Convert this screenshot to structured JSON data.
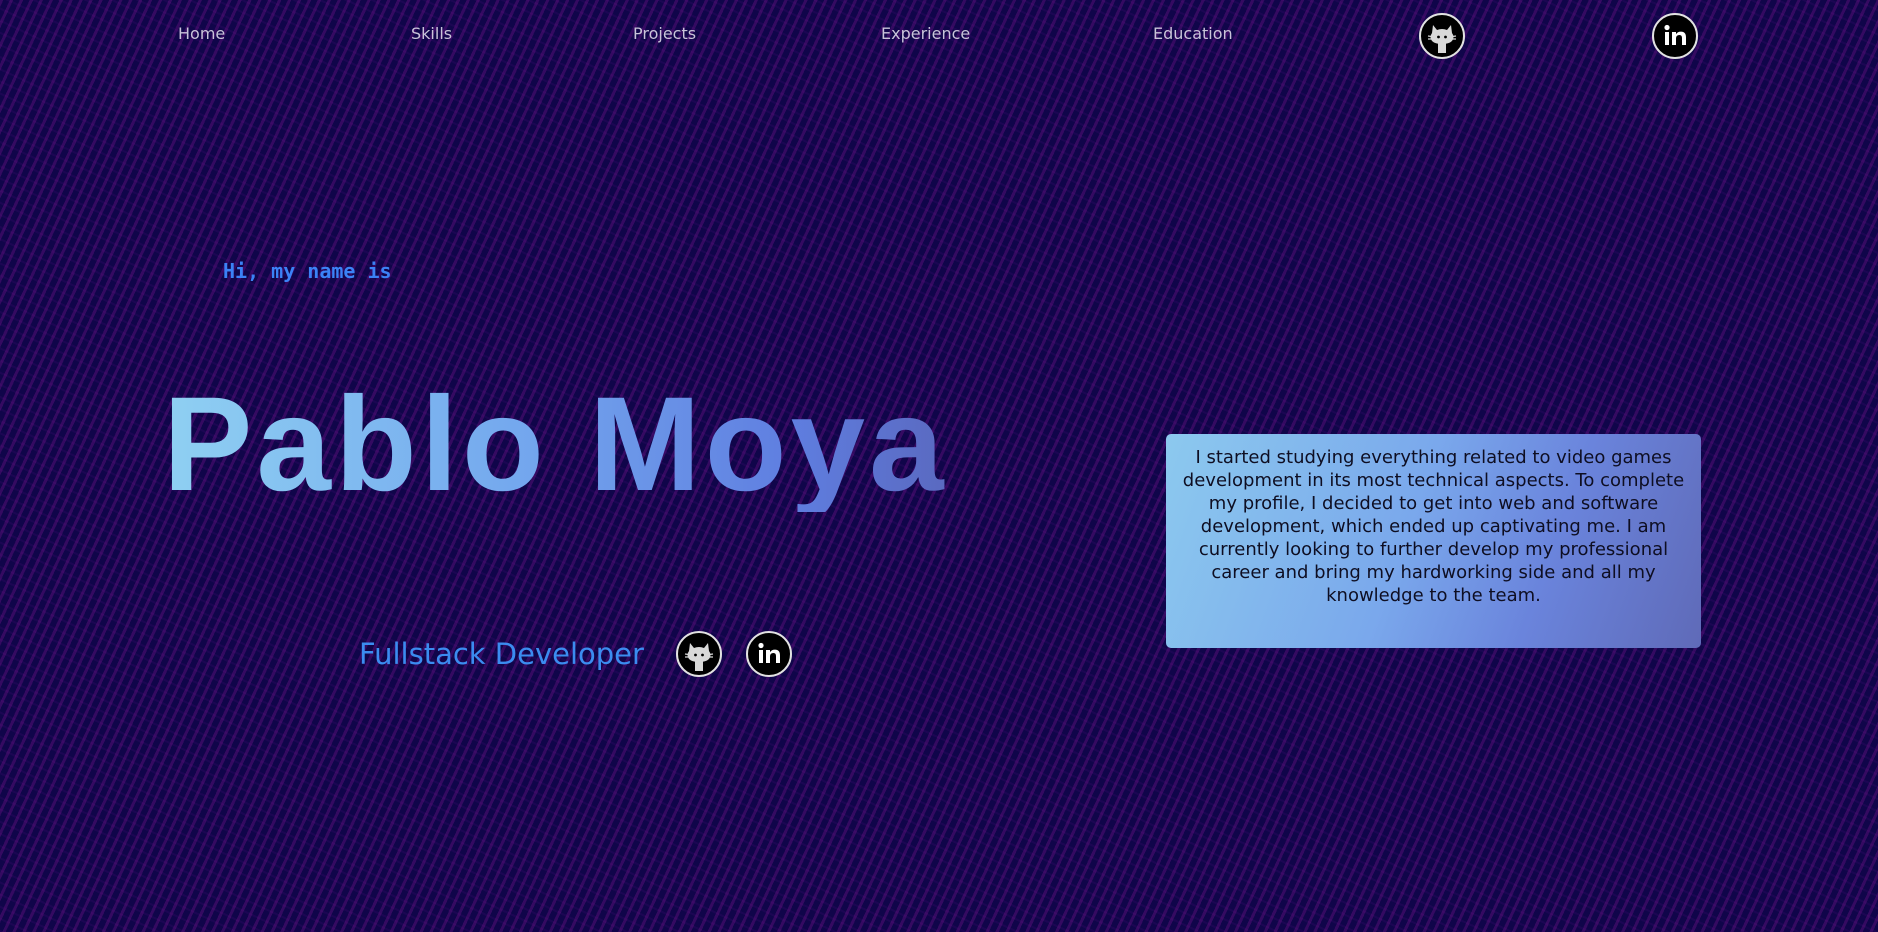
{
  "nav": {
    "links": [
      {
        "label": "Home"
      },
      {
        "label": "Skills"
      },
      {
        "label": "Projects"
      },
      {
        "label": "Experience"
      },
      {
        "label": "Education"
      }
    ],
    "social": [
      {
        "icon": "github-icon"
      },
      {
        "icon": "linkedin-icon"
      }
    ]
  },
  "hero": {
    "greeting": "Hi, my name is",
    "name": "Pablo Moya",
    "role": "Fullstack Developer",
    "social": [
      {
        "icon": "github-icon"
      },
      {
        "icon": "linkedin-icon"
      }
    ]
  },
  "about": {
    "text": "I started studying everything related to video games development in its most technical aspects. To complete my profile, I decided to get into web and software development, which ended up captivating me. I am currently looking to further develop my professional career and bring my hardworking side and all my knowledge to the team."
  },
  "colors": {
    "background": "#10054a",
    "accent": "#3b82f6",
    "name_gradient_start": "#8fd0f2",
    "name_gradient_end": "#5a69c0"
  }
}
